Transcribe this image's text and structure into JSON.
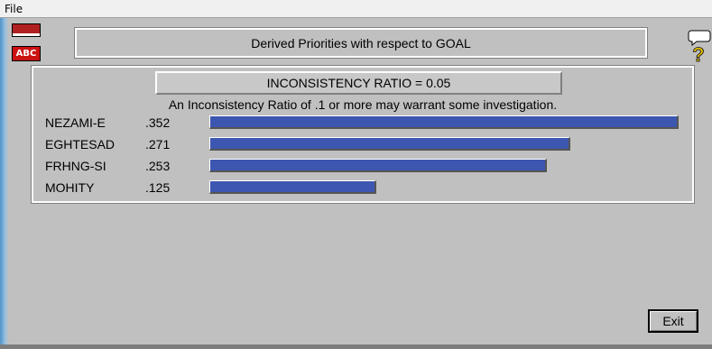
{
  "menu": {
    "file": "File"
  },
  "toolbar": {
    "abc_label": "ABC"
  },
  "header": {
    "title": "Derived Priorities with respect to GOAL"
  },
  "inconsistency": {
    "label": "INCONSISTENCY RATIO = 0.05",
    "warning": "An Inconsistency Ratio of .1 or more may warrant some investigation."
  },
  "priorities": [
    {
      "name": "NEZAMI-E",
      "value": ".352",
      "weight": 0.352
    },
    {
      "name": "EGHTESAD",
      "value": ".271",
      "weight": 0.271
    },
    {
      "name": "FRHNG-SI",
      "value": ".253",
      "weight": 0.253
    },
    {
      "name": "MOHITY",
      "value": ".125",
      "weight": 0.125
    }
  ],
  "buttons": {
    "exit": "Exit"
  },
  "colors": {
    "bar": "#3d56b0",
    "background": "#c0c0c0"
  }
}
